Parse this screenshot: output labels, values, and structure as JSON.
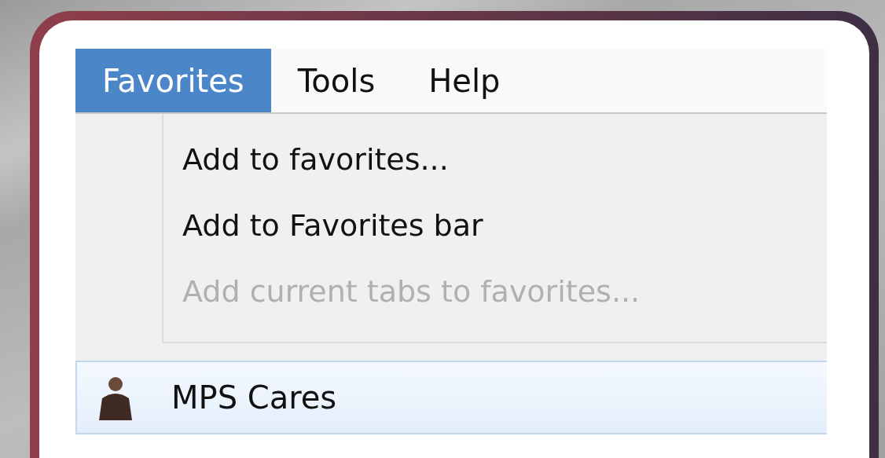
{
  "menu_bar": [
    {
      "label": "Favorites",
      "selected": true
    },
    {
      "label": "Tools",
      "selected": false
    },
    {
      "label": "Help",
      "selected": false
    }
  ],
  "menu_items": [
    {
      "label": "Add to favorites...",
      "disabled": false
    },
    {
      "label": "Add to Favorites bar",
      "disabled": false
    },
    {
      "label": "Add current tabs to favorites...",
      "disabled": true
    }
  ],
  "favorites": [
    {
      "label": "MPS Cares",
      "selected": true
    }
  ]
}
